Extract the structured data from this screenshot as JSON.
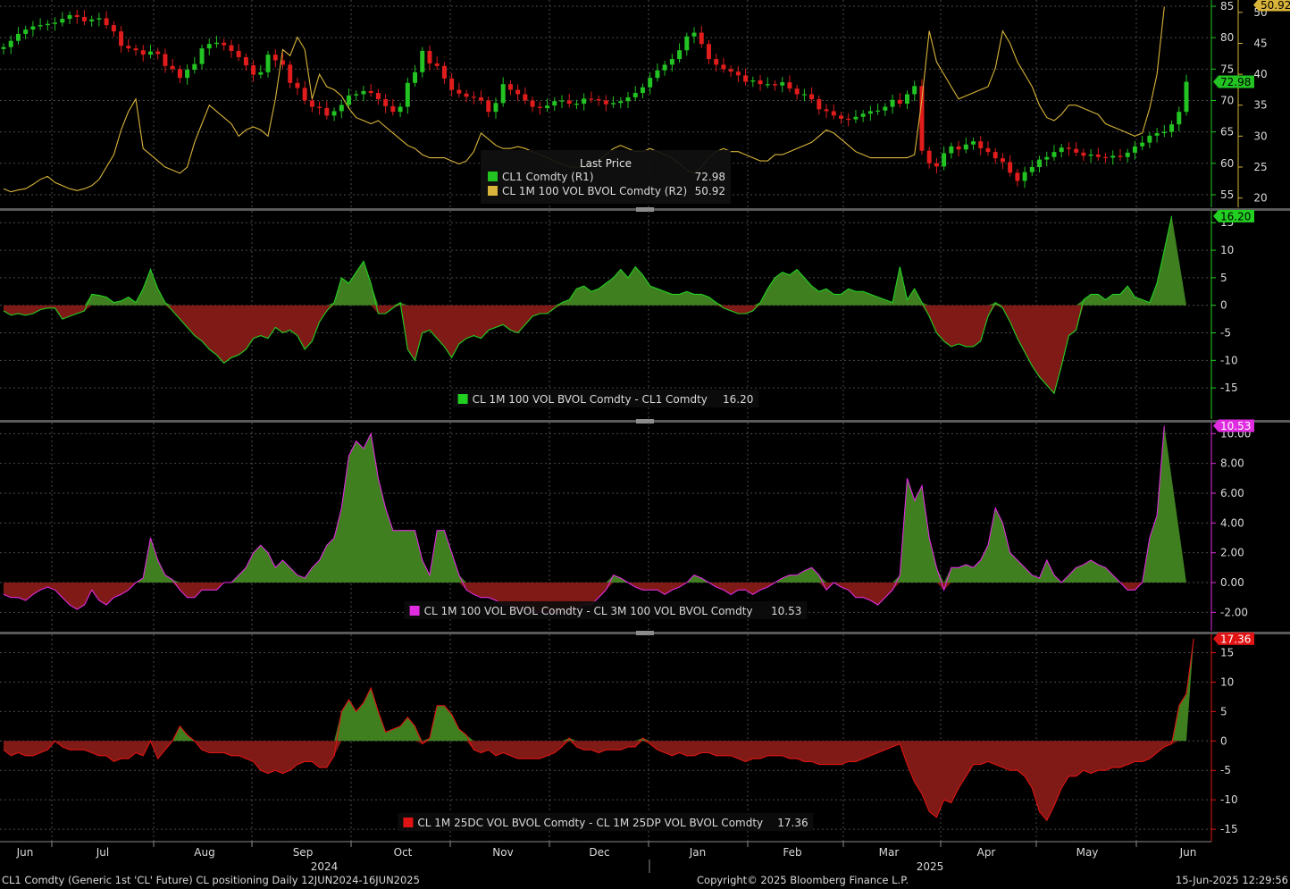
{
  "footer": {
    "left": "CL1 Comdty (Generic 1st 'CL' Future) CL positioning  Daily 12JUN2024-16JUN2025",
    "center": "Copyright© 2025 Bloomberg Finance L.P.",
    "right": "15-Jun-2025 12:29:56"
  },
  "colors": {
    "background": "#000000",
    "up_candle": "#22c322",
    "down_candle": "#e01c1c",
    "vol_line": "#d9b43a",
    "positive_fill": "#3f7f1f",
    "negative_fill": "#7f1a16",
    "green_line": "#22d022",
    "magenta_line": "#e02ce0",
    "red_line": "#e01414"
  },
  "chart_data": [
    {
      "type": "line",
      "panel": "price",
      "legend_title": "Last Price",
      "legend_placement": "center-bottom",
      "series": [
        {
          "name": "CL1 Comdty  (R1)",
          "style": "candlestick",
          "last": "72.98",
          "y": [
            78.5,
            79.5,
            80.6,
            81.3,
            81.8,
            82.0,
            82.2,
            82.4,
            83.0,
            83.6,
            83.3,
            82.6,
            82.9,
            83.1,
            82.0,
            81.0,
            78.7,
            78.3,
            78.0,
            77.3,
            77.8,
            77.4,
            75.5,
            75.0,
            73.6,
            74.9,
            75.8,
            78.3,
            79.0,
            79.2,
            78.8,
            77.9,
            76.9,
            75.6,
            74.1,
            74.5,
            77.3,
            76.4,
            75.7,
            72.8,
            72.0,
            70.0,
            69.0,
            68.8,
            67.6,
            68.3,
            69.3,
            70.8,
            71.0,
            71.5,
            71.2,
            70.2,
            69.1,
            68.2,
            69.0,
            72.8,
            74.5,
            77.9,
            75.9,
            75.5,
            73.5,
            71.7,
            71.1,
            70.6,
            70.5,
            70.0,
            68.2,
            69.6,
            72.6,
            71.7,
            71.0,
            70.0,
            69.0,
            68.8,
            69.2,
            69.9,
            70.0,
            69.5,
            69.5,
            70.3,
            70.2,
            70.0,
            69.4,
            69.6,
            69.9,
            70.5,
            71.2,
            72.1,
            73.6,
            74.8,
            75.7,
            76.6,
            78.0,
            80.2,
            80.8,
            79.0,
            76.6,
            75.7,
            75.0,
            74.6,
            74.0,
            73.0,
            73.2,
            72.6,
            72.6,
            72.4,
            72.9,
            71.9,
            71.0,
            71.0,
            70.2,
            68.6,
            68.3,
            67.6,
            67.1,
            67.0,
            67.4,
            67.9,
            68.3,
            68.4,
            69.0,
            70.1,
            69.5,
            71.0,
            72.3,
            62.0,
            60.0,
            59.5,
            61.6,
            62.7,
            62.2,
            63.0,
            63.5,
            62.4,
            61.8,
            60.8,
            60.2,
            58.5,
            57.2,
            58.6,
            59.4,
            60.6,
            61.0,
            61.8,
            62.5,
            62.3,
            61.7,
            61.2,
            61.4,
            61.0,
            60.9,
            61.2,
            61.0,
            61.7,
            62.7,
            63.3,
            64.4,
            64.8,
            65.0,
            66.2,
            68.2,
            72.98
          ]
        },
        {
          "name": "CL 1M 100 VOL BVOL Comdty  (R2)",
          "style": "line",
          "last": "50.92",
          "y": [
            21.5,
            21.0,
            21.3,
            21.5,
            22.2,
            23.0,
            23.5,
            22.5,
            22.0,
            21.5,
            21.2,
            21.5,
            22.0,
            23.0,
            25.0,
            27.0,
            31.0,
            34.0,
            36.0,
            28.0,
            27.0,
            26.0,
            25.0,
            24.5,
            24.0,
            25.0,
            29.0,
            32.0,
            35.0,
            34.0,
            33.0,
            32.0,
            30.0,
            31.0,
            31.5,
            31.0,
            30.0,
            36.0,
            44.0,
            43.0,
            46.0,
            44.0,
            36.0,
            40.0,
            38.0,
            37.5,
            36.5,
            34.5,
            33.0,
            32.5,
            32.0,
            32.5,
            31.5,
            30.5,
            29.5,
            28.5,
            28.0,
            27.0,
            26.5,
            26.5,
            26.5,
            26.0,
            25.5,
            26.0,
            27.5,
            30.5,
            29.5,
            28.5,
            28.0,
            28.0,
            28.3,
            28.0,
            27.5,
            27.0,
            26.5,
            26.0,
            25.5,
            25.0,
            25.0,
            25.0,
            25.5,
            26.0,
            27.0,
            28.0,
            28.5,
            28.0,
            27.5,
            27.5,
            28.0,
            27.5,
            27.0,
            26.5,
            25.5,
            24.5,
            24.0,
            25.0,
            26.5,
            27.5,
            28.0,
            27.5,
            27.5,
            27.0,
            26.5,
            26.0,
            26.0,
            27.0,
            27.0,
            27.5,
            28.0,
            28.5,
            29.0,
            30.0,
            31.0,
            30.5,
            29.5,
            28.5,
            27.5,
            27.0,
            26.5,
            26.5,
            26.5,
            26.5,
            26.5,
            26.5,
            27.0,
            36.0,
            47.0,
            42.0,
            40.0,
            38.0,
            36.0,
            36.5,
            37.0,
            37.5,
            38.0,
            41.0,
            47.0,
            45.0,
            42.0,
            40.0,
            38.0,
            35.0,
            33.0,
            32.5,
            33.5,
            35.0,
            35.0,
            34.5,
            34.0,
            33.5,
            32.0,
            31.5,
            31.0,
            30.5,
            30.0,
            30.5,
            34.5,
            40.0,
            50.92
          ]
        }
      ],
      "ylim_right_1": [
        53,
        86
      ],
      "ticks_right_1": [
        55,
        60,
        65,
        70,
        75,
        80,
        85
      ],
      "ylim_right_2": [
        18.5,
        52
      ],
      "ticks_right_2": [
        20,
        25,
        30,
        35,
        40,
        45,
        50
      ],
      "grid": true
    },
    {
      "type": "area",
      "panel": "spread_1",
      "legend_placement": "center-bottom",
      "series": [
        {
          "name": "CL 1M 100 VOL BVOL Comdty - CL1 Comdty",
          "last": "16.20",
          "y": [
            -1.0,
            -1.8,
            -1.5,
            -1.8,
            -1.5,
            -0.8,
            -0.5,
            -0.5,
            -2.5,
            -2.0,
            -1.5,
            -1.0,
            2.0,
            1.8,
            1.5,
            0.5,
            0.8,
            1.5,
            0.5,
            3.0,
            6.5,
            3.0,
            0.5,
            -1.0,
            -2.5,
            -4.0,
            -5.5,
            -6.5,
            -8.0,
            -9.0,
            -10.5,
            -9.5,
            -9.0,
            -8.0,
            -6.0,
            -5.5,
            -6.0,
            -4.0,
            -5.0,
            -4.5,
            -5.5,
            -8.0,
            -6.5,
            -3.0,
            -1.0,
            0.5,
            5.0,
            4.0,
            6.0,
            8.0,
            4.0,
            -1.5,
            -1.5,
            -0.5,
            0.5,
            -8.0,
            -10.0,
            -5.0,
            -4.5,
            -6.0,
            -7.5,
            -9.5,
            -7.0,
            -6.0,
            -5.5,
            -6.0,
            -4.5,
            -4.0,
            -3.5,
            -4.5,
            -5.0,
            -3.5,
            -2.0,
            -1.5,
            -1.5,
            -0.5,
            0.5,
            1.0,
            3.0,
            3.5,
            2.5,
            3.0,
            4.0,
            5.0,
            6.5,
            5.0,
            7.0,
            5.5,
            3.5,
            3.0,
            2.5,
            2.0,
            2.0,
            2.5,
            2.0,
            2.0,
            1.5,
            0.5,
            -0.5,
            -1.0,
            -1.5,
            -1.5,
            -1.0,
            0.5,
            3.0,
            5.0,
            6.0,
            5.5,
            6.5,
            5.0,
            3.5,
            2.5,
            3.0,
            2.0,
            2.0,
            3.0,
            2.5,
            2.5,
            2.0,
            1.5,
            1.0,
            0.5,
            7.0,
            1.0,
            3.0,
            0.5,
            -2.0,
            -5.0,
            -6.5,
            -7.5,
            -7.0,
            -7.5,
            -7.5,
            -6.5,
            -2.0,
            0.5,
            -0.5,
            -3.0,
            -6.0,
            -8.5,
            -11.0,
            -13.0,
            -14.5,
            -16.0,
            -11.0,
            -5.5,
            -4.5,
            1.0,
            2.0,
            2.0,
            1.0,
            2.0,
            2.0,
            3.5,
            1.5,
            1.0,
            0.5,
            4.0,
            10.0,
            16.2
          ]
        }
      ],
      "ylim": [
        -20,
        16.5
      ],
      "ticks": [
        -15,
        -10,
        -5,
        0,
        5,
        10,
        15
      ],
      "grid": true
    },
    {
      "type": "area",
      "panel": "spread_2",
      "legend_placement": "center-bottom",
      "series": [
        {
          "name": "CL 1M 100 VOL BVOL Comdty - CL 3M 100 VOL BVOL Comdty",
          "last": "10.53",
          "y": [
            -0.8,
            -1.0,
            -1.0,
            -1.2,
            -0.8,
            -0.5,
            -0.3,
            -0.5,
            -1.0,
            -1.5,
            -1.8,
            -1.5,
            -0.5,
            -1.2,
            -1.5,
            -1.0,
            -0.8,
            -0.5,
            0.0,
            0.3,
            3.0,
            1.5,
            0.5,
            0.2,
            -0.5,
            -1.0,
            -1.0,
            -0.5,
            -0.5,
            -0.5,
            0.0,
            0.0,
            0.5,
            1.0,
            2.0,
            2.5,
            2.0,
            1.0,
            1.5,
            1.0,
            0.5,
            0.3,
            1.0,
            1.5,
            2.5,
            3.0,
            5.0,
            8.5,
            9.5,
            9.0,
            10.0,
            7.0,
            5.0,
            3.5,
            3.5,
            3.5,
            3.5,
            1.5,
            0.5,
            3.5,
            3.5,
            2.0,
            0.5,
            -0.5,
            -0.8,
            -1.0,
            -1.0,
            -1.2,
            -1.5,
            -1.5,
            -1.8,
            -1.8,
            -2.0,
            -2.0,
            -2.0,
            -2.0,
            -2.0,
            -2.0,
            -1.8,
            -1.5,
            -1.5,
            -1.0,
            -0.5,
            0.5,
            0.3,
            0.0,
            -0.3,
            -0.5,
            -0.5,
            -0.5,
            -0.8,
            -0.5,
            -0.3,
            0.0,
            0.5,
            0.3,
            0.0,
            -0.3,
            -0.5,
            -0.8,
            -0.5,
            -0.5,
            -0.8,
            -0.5,
            -0.3,
            0.0,
            0.3,
            0.5,
            0.5,
            0.8,
            1.0,
            0.5,
            -0.5,
            0.0,
            -0.3,
            -0.5,
            -1.0,
            -1.0,
            -1.2,
            -1.5,
            -1.0,
            -0.5,
            0.5,
            7.0,
            5.5,
            6.5,
            3.0,
            1.0,
            -0.5,
            1.0,
            1.0,
            1.2,
            1.0,
            1.5,
            2.5,
            5.0,
            4.0,
            2.0,
            1.5,
            1.0,
            0.5,
            0.3,
            1.5,
            0.5,
            0.0,
            0.5,
            1.0,
            1.2,
            1.5,
            1.2,
            1.0,
            0.5,
            0.0,
            -0.5,
            -0.5,
            0.0,
            3.0,
            4.5,
            10.53
          ]
        }
      ],
      "ylim": [
        -3.0,
        10.5
      ],
      "ticks": [
        -2.0,
        0.0,
        2.0,
        4.0,
        6.0,
        8.0,
        10.0
      ],
      "tick_labels": [
        "-2.00",
        "0.00",
        "2.00",
        "4.00",
        "6.00",
        "8.00",
        "10.00"
      ],
      "grid": true
    },
    {
      "type": "area",
      "panel": "spread_3",
      "legend_placement": "center-bottom",
      "series": [
        {
          "name": "CL 1M 25DC VOL BVOL Comdty - CL 1M 25DP VOL BVOL Comdty",
          "last": "17.36",
          "y": [
            -1.5,
            -2.5,
            -2.0,
            -2.5,
            -2.5,
            -2.0,
            -1.5,
            0.0,
            -1.0,
            -1.5,
            -1.5,
            -1.5,
            -2.0,
            -2.5,
            -2.5,
            -3.5,
            -3.0,
            -3.0,
            -2.0,
            -2.5,
            0.0,
            -3.0,
            -1.5,
            0.0,
            2.5,
            1.0,
            0.0,
            -1.5,
            -2.0,
            -2.0,
            -2.0,
            -2.5,
            -2.5,
            -3.0,
            -3.5,
            -5.0,
            -5.5,
            -5.0,
            -5.5,
            -5.0,
            -4.0,
            -3.5,
            -3.5,
            -4.5,
            -4.5,
            -2.5,
            5.0,
            7.0,
            5.0,
            6.5,
            9.0,
            5.0,
            1.5,
            2.0,
            2.5,
            4.0,
            2.5,
            -0.5,
            0.5,
            6.0,
            6.0,
            4.5,
            2.0,
            1.0,
            -1.5,
            -2.0,
            -1.5,
            -2.5,
            -2.0,
            -2.5,
            -3.0,
            -3.0,
            -3.0,
            -3.0,
            -2.5,
            -2.0,
            -1.0,
            0.5,
            -1.0,
            -1.5,
            -1.5,
            -2.0,
            -1.5,
            -1.5,
            -1.5,
            -1.0,
            -1.0,
            0.5,
            -0.5,
            -1.5,
            -2.0,
            -2.5,
            -2.0,
            -2.5,
            -2.5,
            -2.0,
            -2.0,
            -2.5,
            -2.5,
            -2.5,
            -3.0,
            -3.5,
            -3.0,
            -3.0,
            -2.5,
            -2.5,
            -2.5,
            -3.0,
            -3.0,
            -3.5,
            -3.5,
            -4.0,
            -4.0,
            -4.0,
            -4.0,
            -3.5,
            -3.5,
            -3.0,
            -2.5,
            -2.0,
            -1.5,
            -1.0,
            -0.5,
            -4.0,
            -7.0,
            -9.0,
            -12.0,
            -13.0,
            -10.0,
            -10.5,
            -8.0,
            -6.0,
            -4.0,
            -4.0,
            -3.5,
            -4.0,
            -4.5,
            -5.0,
            -5.0,
            -6.0,
            -8.0,
            -12.0,
            -13.5,
            -11.0,
            -8.0,
            -6.0,
            -6.0,
            -5.0,
            -5.5,
            -5.0,
            -5.0,
            -4.5,
            -4.5,
            -4.0,
            -3.5,
            -3.5,
            -3.0,
            -2.0,
            -1.0,
            -0.5,
            6.0,
            8.0,
            17.36
          ]
        }
      ],
      "ylim": [
        -16.5,
        17.5
      ],
      "ticks": [
        -15,
        -10,
        -5,
        0,
        5,
        10,
        15
      ],
      "grid": true
    }
  ],
  "x_axis": {
    "months": [
      "Jun",
      "Jul",
      "Aug",
      "Sep",
      "Oct",
      "Nov",
      "Dec",
      "Jan",
      "Feb",
      "Mar",
      "Apr",
      "May",
      "Jun"
    ],
    "years": [
      "2024",
      "2025"
    ]
  }
}
